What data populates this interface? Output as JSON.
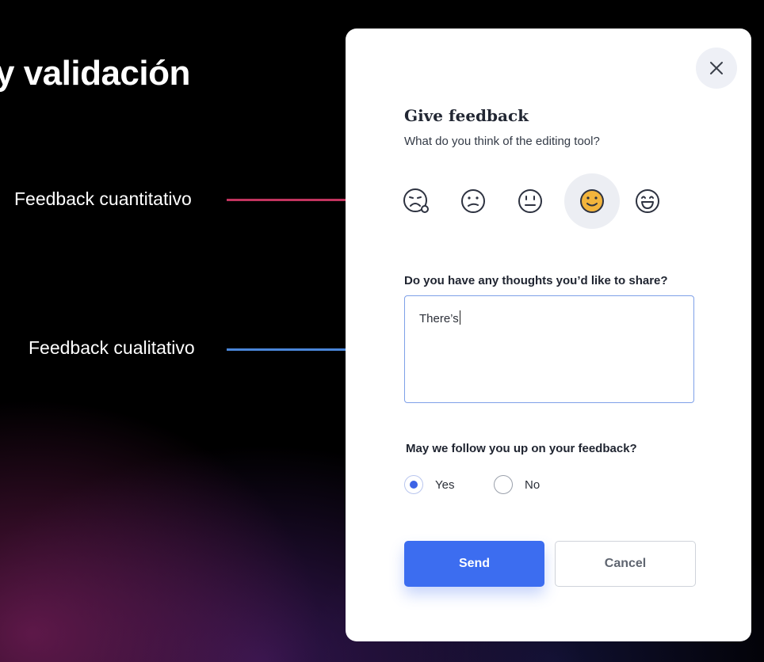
{
  "slide": {
    "title_fragment": "y validación",
    "annotation_quantitative": "Feedback cuantitativo",
    "annotation_qualitative": "Feedback cualitativo",
    "colors": {
      "quantitative_line": "#c2345f",
      "qualitative_line": "#4a86d9"
    }
  },
  "dialog": {
    "close_icon": "close-icon",
    "title": "Give feedback",
    "subtitle": "What do you think of the editing tool?",
    "ratings": [
      {
        "icon": "very-sad-face-icon",
        "selected": false
      },
      {
        "icon": "confused-face-icon",
        "selected": false
      },
      {
        "icon": "neutral-face-icon",
        "selected": false
      },
      {
        "icon": "smiling-face-icon",
        "selected": true
      },
      {
        "icon": "happy-face-icon",
        "selected": false
      }
    ],
    "thoughts_label": "Do you have any thoughts you’d like to share?",
    "thoughts_value": "There’s",
    "follow_up_label": "May we follow you up on your feedback?",
    "follow_up_options": [
      {
        "label": "Yes",
        "checked": true
      },
      {
        "label": "No",
        "checked": false
      }
    ],
    "send_label": "Send",
    "cancel_label": "Cancel",
    "colors": {
      "primary": "#3c6df0",
      "selected_emoji": "#f2b43c"
    }
  }
}
